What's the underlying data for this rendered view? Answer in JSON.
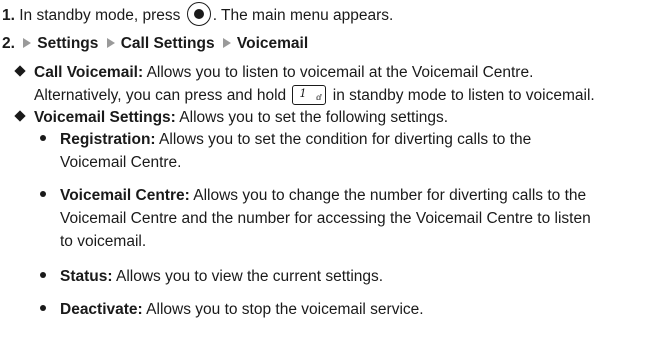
{
  "step1": {
    "num": "1.",
    "before": "In standby mode, press",
    "after": ". The main menu appears.",
    "key_icon": "ok-center-key-icon"
  },
  "step2": {
    "num": "2.",
    "path": [
      "Settings",
      "Call Settings",
      "Voicemail"
    ]
  },
  "call_voicemail": {
    "title": "Call Voicemail:",
    "line1": " Allows you to listen to voicemail at the Voicemail Centre.",
    "line2_before": "Alternatively, you can press and hold",
    "line2_after": " in standby mode to listen to voicemail.",
    "key_label": "1",
    "key_symbol": "ⅆ"
  },
  "voicemail_settings": {
    "title": "Voicemail Settings:",
    "desc": " Allows you to set the following settings.",
    "items": [
      {
        "title": "Registration:",
        "lines": [
          " Allows you to set the condition for diverting calls to the",
          "Voicemail Centre."
        ]
      },
      {
        "title": "Voicemail Centre:",
        "lines": [
          " Allows you to change the number for diverting calls to the",
          "Voicemail Centre and the number for accessing the Voicemail Centre to listen",
          "to voicemail."
        ]
      },
      {
        "title": "Status:",
        "lines": [
          " Allows you to view the current settings."
        ]
      },
      {
        "title": "Deactivate:",
        "lines": [
          " Allows you to stop the voicemail service."
        ]
      }
    ]
  }
}
